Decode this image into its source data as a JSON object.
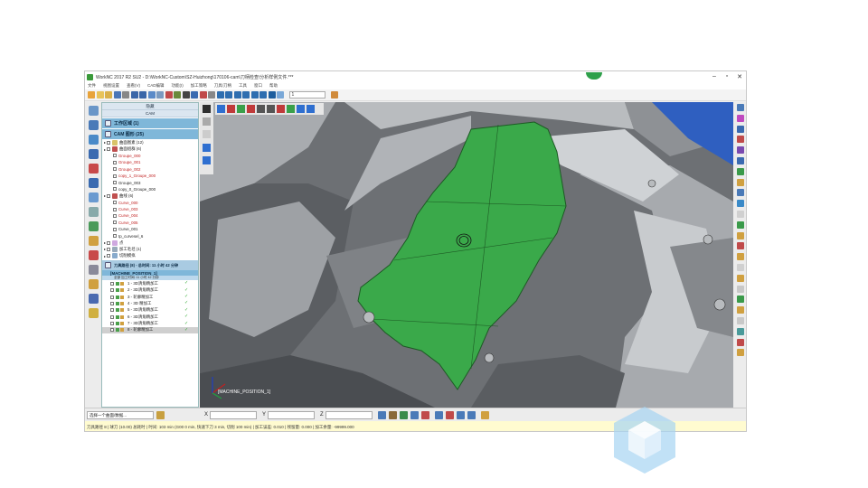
{
  "window": {
    "title": "WorkNC 2017 R2 SU2 - D:\\WorkNC-Custom\\SZ-Huizhong\\170106-cam\\刀柄检查\\分析样例文件.***",
    "controls": [
      "–",
      "▫",
      "✕"
    ]
  },
  "menu": [
    "文件",
    "视图设置",
    "查看(V)",
    "CAD编辑",
    "功能(I)",
    "加工策略",
    "刀具/刀柄",
    "工具",
    "窗口",
    "帮助"
  ],
  "toolbar": {
    "dropdown_value": "1"
  },
  "panel": {
    "tab1": "隐藏",
    "tab2": "CAM",
    "workzone": "工作区域 (1)",
    "cam_header": "CAM 图形 (25)",
    "tree": [
      {
        "label": "曲面图素 (12)",
        "cls": "",
        "indent": 1,
        "icon": "#d9c36a"
      },
      {
        "label": "曲面组群 (6)",
        "cls": "",
        "indent": 1,
        "icon": "#c05050"
      },
      {
        "label": "Groupe_000",
        "cls": "red",
        "indent": 2,
        "icon": ""
      },
      {
        "label": "Groupe_001",
        "cls": "red",
        "indent": 2,
        "icon": ""
      },
      {
        "label": "Groupe_002",
        "cls": "red",
        "indent": 2,
        "icon": ""
      },
      {
        "label": "copy_1_Groupe_000",
        "cls": "red",
        "indent": 2,
        "icon": ""
      },
      {
        "label": "Groupe_003",
        "cls": "",
        "indent": 2,
        "icon": ""
      },
      {
        "label": "copy_0_Groupe_000",
        "cls": "",
        "indent": 2,
        "icon": ""
      },
      {
        "label": "曲线 (6)",
        "cls": "",
        "indent": 1,
        "icon": "#c05050"
      },
      {
        "label": "Curve_000",
        "cls": "red",
        "indent": 2,
        "icon": ""
      },
      {
        "label": "Curve_003",
        "cls": "red",
        "indent": 2,
        "icon": ""
      },
      {
        "label": "Curve_004",
        "cls": "red",
        "indent": 2,
        "icon": ""
      },
      {
        "label": "Curve_005",
        "cls": "red",
        "indent": 2,
        "icon": ""
      },
      {
        "label": "Curve_001",
        "cls": "",
        "indent": 2,
        "icon": ""
      },
      {
        "label": "tp_curvesel_6",
        "cls": "",
        "indent": 2,
        "icon": ""
      },
      {
        "label": "点",
        "cls": "",
        "indent": 1,
        "icon": "#cfa8e0"
      },
      {
        "label": "加工毛坯 (1)",
        "cls": "",
        "indent": 1,
        "icon": "#9ab"
      },
      {
        "label": "切削模拟",
        "cls": "",
        "indent": 1,
        "icon": "#8ac"
      }
    ],
    "toolpath_header": "刀具路径 (8) - 总时间: 11 小时 42 分钟",
    "machine": "[MACHINE_POSITION_1]",
    "machine_sub": "全部 加工时间: 11 小时 42 分钟",
    "operations": [
      {
        "label": "1 - 3D清角精加工",
        "cls": ""
      },
      {
        "label": "2 - 3D清角精加工",
        "cls": ""
      },
      {
        "label": "3 - 轮廓精加工",
        "cls": ""
      },
      {
        "label": "4 - 3D 精加工",
        "cls": ""
      },
      {
        "label": "5 - 3D清角精加工",
        "cls": ""
      },
      {
        "label": "6 - 3D清角精加工",
        "cls": ""
      },
      {
        "label": "7 - 3D清角精加工",
        "cls": ""
      },
      {
        "label": "8 - 轮廓精加工",
        "cls": "selected"
      }
    ]
  },
  "viewport": {
    "axis_label": "[MACHINE_POSITION_1]",
    "highlight_color": "#3aa94a",
    "model_color": "#8c8f93"
  },
  "coordbar": {
    "selection_placeholder": "选择一个曲面/数据...",
    "x_label": "X",
    "y_label": "Y",
    "z_label": "Z"
  },
  "status": "刀具路径 8 | 球刀 (10.00) 总耗时 | 时间: 103 min (G00 0 min, 快速下刀 3 min, 切削 100 min) | 加工误差: 0.010 | 残留量: 0.000 | 加工余量: -99999.000"
}
